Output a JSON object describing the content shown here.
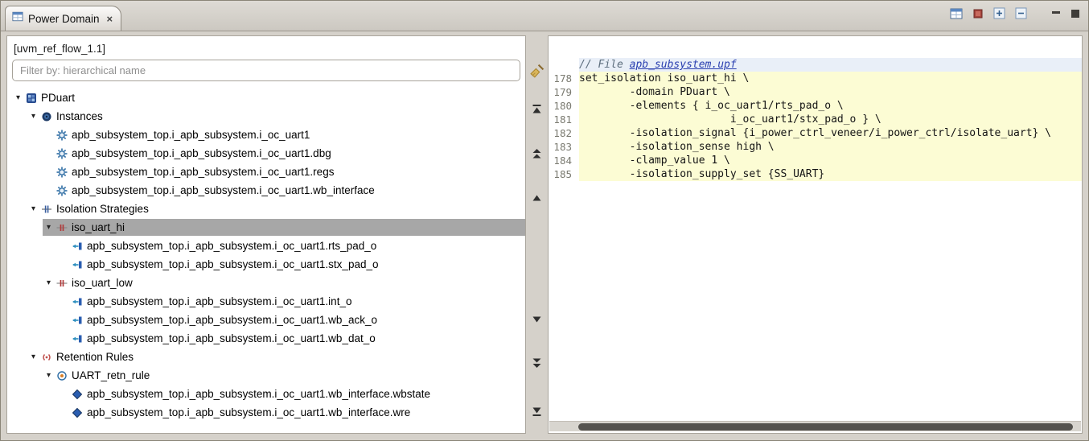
{
  "tab": {
    "title": "Power Domain"
  },
  "toolbar": {
    "buttons": [
      {
        "name": "grid-view",
        "icon": "grid"
      },
      {
        "name": "red-marker",
        "icon": "red-square"
      },
      {
        "name": "expand-all",
        "icon": "plus-box"
      },
      {
        "name": "collapse-all",
        "icon": "minus-box"
      },
      {
        "name": "minimize",
        "icon": "minimize"
      },
      {
        "name": "maximize",
        "icon": "maximize"
      }
    ]
  },
  "project_label": "[uvm_ref_flow_1.1]",
  "filter": {
    "placeholder": "Filter by: hierarchical name"
  },
  "tree": {
    "items": [
      {
        "label": "PDuart",
        "depth": 0,
        "icon": "domain",
        "expanded": true
      },
      {
        "label": "Instances",
        "depth": 1,
        "icon": "instances",
        "expanded": true
      },
      {
        "label": "apb_subsystem_top.i_apb_subsystem.i_oc_uart1",
        "depth": 2,
        "icon": "instance"
      },
      {
        "label": "apb_subsystem_top.i_apb_subsystem.i_oc_uart1.dbg",
        "depth": 2,
        "icon": "instance"
      },
      {
        "label": "apb_subsystem_top.i_apb_subsystem.i_oc_uart1.regs",
        "depth": 2,
        "icon": "instance"
      },
      {
        "label": "apb_subsystem_top.i_apb_subsystem.i_oc_uart1.wb_interface",
        "depth": 2,
        "icon": "instance"
      },
      {
        "label": "Isolation Strategies",
        "depth": 1,
        "icon": "iso-group",
        "expanded": true
      },
      {
        "label": "iso_uart_hi",
        "depth": 2,
        "icon": "iso-strategy",
        "expanded": true,
        "selected": true
      },
      {
        "label": "apb_subsystem_top.i_apb_subsystem.i_oc_uart1.rts_pad_o",
        "depth": 3,
        "icon": "port"
      },
      {
        "label": "apb_subsystem_top.i_apb_subsystem.i_oc_uart1.stx_pad_o",
        "depth": 3,
        "icon": "port"
      },
      {
        "label": "iso_uart_low",
        "depth": 2,
        "icon": "iso-strategy",
        "expanded": true
      },
      {
        "label": "apb_subsystem_top.i_apb_subsystem.i_oc_uart1.int_o",
        "depth": 3,
        "icon": "port"
      },
      {
        "label": "apb_subsystem_top.i_apb_subsystem.i_oc_uart1.wb_ack_o",
        "depth": 3,
        "icon": "port"
      },
      {
        "label": "apb_subsystem_top.i_apb_subsystem.i_oc_uart1.wb_dat_o",
        "depth": 3,
        "icon": "port"
      },
      {
        "label": "Retention Rules",
        "depth": 1,
        "icon": "retention-group",
        "expanded": true
      },
      {
        "label": "UART_retn_rule",
        "depth": 2,
        "icon": "retention-rule",
        "expanded": true
      },
      {
        "label": "apb_subsystem_top.i_apb_subsystem.i_oc_uart1.wb_interface.wbstate",
        "depth": 3,
        "icon": "element"
      },
      {
        "label": "apb_subsystem_top.i_apb_subsystem.i_oc_uart1.wb_interface.wre",
        "depth": 3,
        "icon": "element"
      }
    ]
  },
  "nav_strip": {
    "buttons": [
      {
        "name": "scroll-to-top",
        "icon": "to-top"
      },
      {
        "name": "scroll-page-up",
        "icon": "double-up"
      },
      {
        "name": "scroll-up",
        "icon": "up"
      },
      {
        "name": "scroll-down",
        "icon": "down"
      },
      {
        "name": "scroll-page-down",
        "icon": "double-down"
      },
      {
        "name": "scroll-to-bottom",
        "icon": "to-bottom"
      }
    ]
  },
  "code": {
    "file_comment_prefix": "// File ",
    "file_name": "apb_subsystem.upf",
    "lines": [
      {
        "num": "178",
        "text": "set_isolation iso_uart_hi \\",
        "hl": true
      },
      {
        "num": "179",
        "text": "        -domain PDuart \\",
        "hl": true
      },
      {
        "num": "180",
        "text": "        -elements { i_oc_uart1/rts_pad_o \\",
        "hl": true
      },
      {
        "num": "181",
        "text": "                        i_oc_uart1/stx_pad_o } \\",
        "hl": true
      },
      {
        "num": "182",
        "text": "        -isolation_signal {i_power_ctrl_veneer/i_power_ctrl/isolate_uart} \\",
        "hl": true
      },
      {
        "num": "183",
        "text": "        -isolation_sense high \\",
        "hl": true
      },
      {
        "num": "184",
        "text": "        -clamp_value 1 \\",
        "hl": true
      },
      {
        "num": "185",
        "text": "        -isolation_supply_set {SS_UART}",
        "hl": true
      }
    ]
  },
  "colors": {
    "chrome": "#d5d1ca",
    "selection": "#a7a7a7",
    "line_highlight": "#fcfcd4",
    "comment": "#5d6e7e",
    "link": "#2b40b0"
  }
}
